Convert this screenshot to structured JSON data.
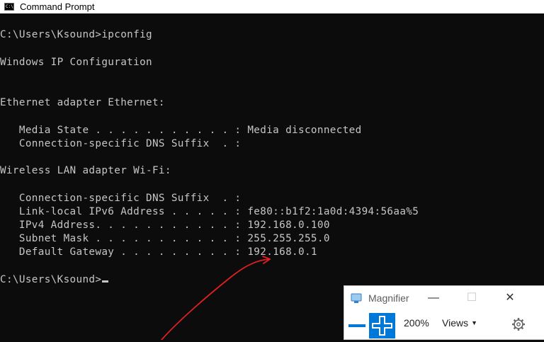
{
  "window": {
    "title": "Command Prompt",
    "icon_text": "C:\\"
  },
  "console": {
    "lines": [
      "C:\\Users\\Ksound>ipconfig",
      "Windows IP Configuration",
      "Ethernet adapter Ethernet:",
      "   Media State . . . . . . . . . . . : Media disconnected",
      "   Connection-specific DNS Suffix  . :",
      "Wireless LAN adapter Wi-Fi:",
      "   Connection-specific DNS Suffix  . :",
      "   Link-local IPv6 Address . . . . . : fe80::b1f2:1a0d:4394:56aa%5",
      "   IPv4 Address. . . . . . . . . . . : 192.168.0.100",
      "   Subnet Mask . . . . . . . . . . . : 255.255.255.0",
      "   Default Gateway . . . . . . . . . : 192.168.0.1",
      "C:\\Users\\Ksound>"
    ]
  },
  "magnifier": {
    "title": "Magnifier",
    "minimize": "—",
    "maximize": "☐",
    "close": "✕",
    "zoom_level": "200%",
    "views_label": "Views",
    "views_caret": "▼",
    "zoom_out_icon": "minus-icon",
    "zoom_in_icon": "plus-icon",
    "settings_icon": "gear-icon"
  },
  "colors": {
    "console_bg": "#0c0c0c",
    "console_text": "#c6c6c6",
    "accent": "#0078d7",
    "annotation": "#e02020"
  }
}
